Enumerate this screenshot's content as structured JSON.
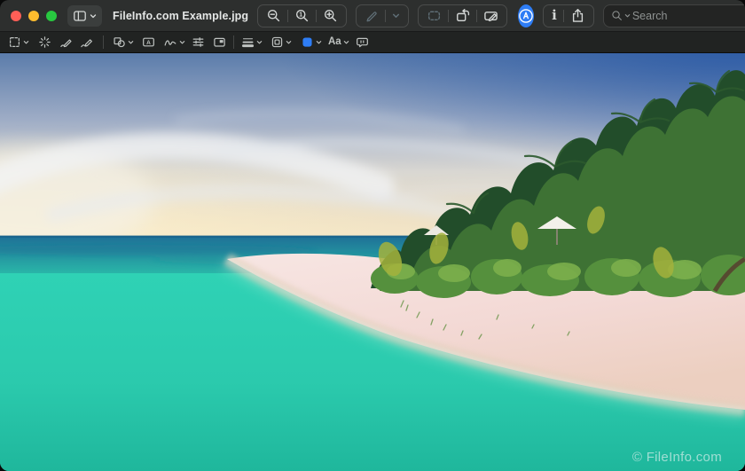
{
  "window": {
    "title": "FileInfo.com Example.jpg"
  },
  "colors": {
    "accentBlue": "#2e7df5",
    "trafficRed": "#ff5f57",
    "trafficYellow": "#febc2e",
    "trafficGreen": "#28c840",
    "titlebarBg": "#2d2f2e",
    "markupbarBg": "#212322",
    "fillSwatch": "#2e7df5"
  },
  "titlebar": {
    "info_label": "i",
    "search_placeholder": "Search",
    "buttons": [
      "sidebar-toggle",
      "zoom-out",
      "actual-size",
      "zoom-in",
      "pencil-markup",
      "crop",
      "rotate",
      "show-markup-toolbar",
      "markup-active",
      "info",
      "share",
      "search"
    ]
  },
  "markup_toolbar": {
    "text_tool_label": "A",
    "text_style_label": "Aa",
    "actual_size_label": "1",
    "tools": [
      "selection-tools",
      "instant-alpha",
      "sketch",
      "draw",
      "shapes",
      "text",
      "sign",
      "adjust-color",
      "adjust-size",
      "shape-style",
      "border-color",
      "fill-color",
      "text-style",
      "annotate"
    ]
  },
  "canvas": {
    "watermark": "© FileInfo.com",
    "scene_description": "tropical island beach, turquoise lagoon, pink sand, palm trees, white umbrellas, wispy clouds"
  }
}
